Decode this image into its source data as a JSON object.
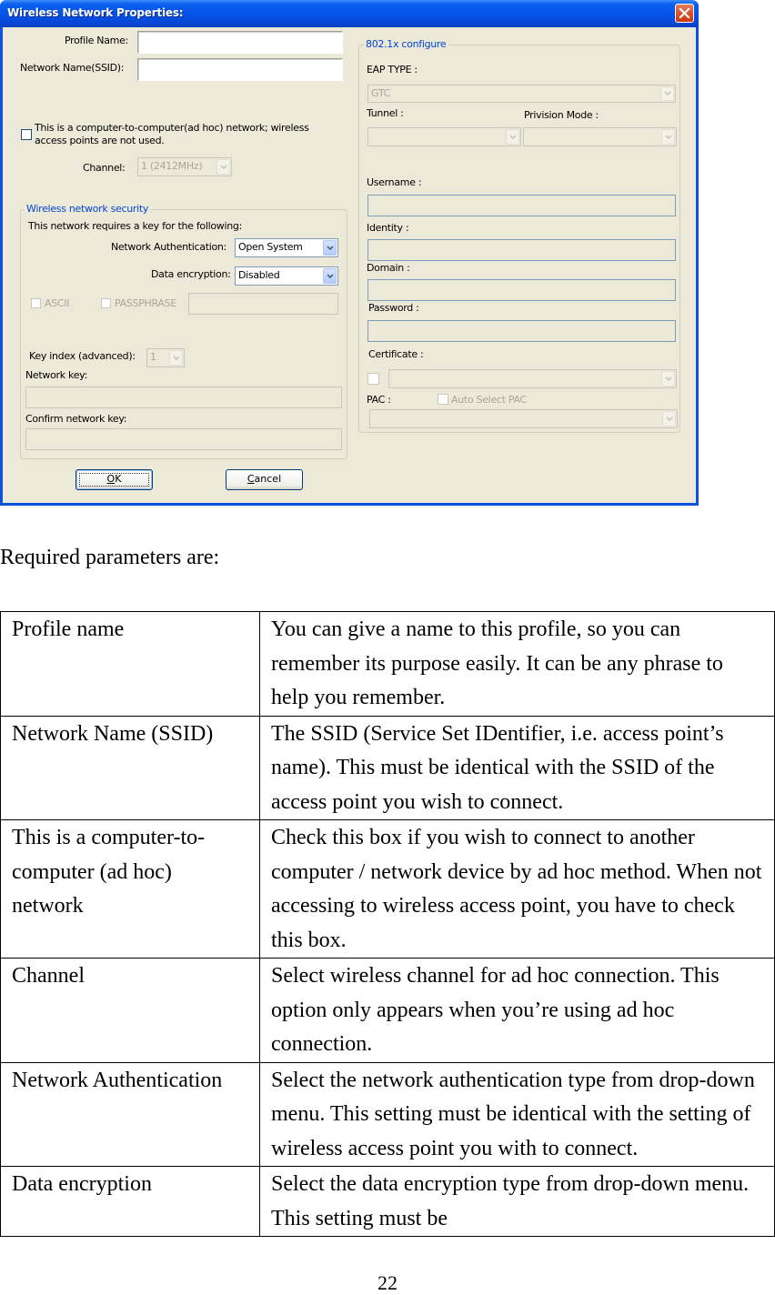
{
  "dialog": {
    "title": "Wireless Network Properties:",
    "profile_name_label": "Profile Name:",
    "profile_name_value": "",
    "ssid_label": "Network Name(SSID):",
    "ssid_value": "",
    "adhoc_line1": "This is a computer-to-computer(ad hoc) network; wireless",
    "adhoc_line2": "access points are not used.",
    "adhoc_checked": false,
    "channel_label": "Channel:",
    "channel_value": "1  (2412MHz)",
    "security": {
      "group_title": "Wireless network security",
      "requires_text": "This network requires a key for the following:",
      "auth_label": "Network Authentication:",
      "auth_value": "Open System",
      "encryption_label": "Data encryption:",
      "encryption_value": "Disabled",
      "ascii_label": "ASCII",
      "passphrase_label": "PASSPHRASE",
      "key_index_label": "Key index (advanced):",
      "key_index_value": "1",
      "network_key_label": "Network key:",
      "confirm_key_label": "Confirm network key:"
    },
    "dot1x": {
      "group_title": "802.1x configure",
      "eap_type_label": "EAP TYPE :",
      "eap_type_value": "GTC",
      "tunnel_label": "Tunnel :",
      "tunnel_value": "",
      "provision_label": "Privision Mode :",
      "provision_value": "",
      "username_label": "Username :",
      "identity_label": "Identity :",
      "domain_label": "Domain :",
      "password_label": "Password :",
      "certificate_label": "Certificate :",
      "pac_label": "PAC :",
      "auto_pac_label": "Auto Select PAC"
    },
    "ok_label": "OK",
    "ok_mnemonic": "O",
    "ok_rest": "K",
    "cancel_mnemonic": "C",
    "cancel_rest": "ancel",
    "colors": {
      "titlebar": "#0551e6",
      "client": "#ece9d8",
      "group_title": "#0046d5",
      "close": "#d84b24"
    }
  },
  "document": {
    "intro": "Required parameters are:",
    "rows": [
      {
        "name": "Profile name",
        "desc": "You can give a name to this profile, so you can remember its purpose easily. It can be any phrase to help you remember."
      },
      {
        "name": "Network Name (SSID)",
        "desc": "The SSID (Service Set IDentifier, i.e. access point’s name). This must be identical with the SSID of the access point you wish to connect."
      },
      {
        "name": "This is a computer-to-computer (ad hoc) network",
        "desc": "Check this box if you wish to connect to another computer / network device by ad hoc method. When not accessing to wireless access point, you have to check this box."
      },
      {
        "name": "Channel",
        "desc": "Select wireless channel for ad hoc connection. This option only appears when you’re using ad hoc connection."
      },
      {
        "name": "Network Authentication",
        "desc": "Select the network authentication type from drop-down menu. This setting must be identical with the setting of wireless access point you with to connect."
      },
      {
        "name": "Data encryption",
        "desc": "Select the data encryption type from drop-down menu. This setting must be"
      }
    ],
    "page_number": "22"
  }
}
